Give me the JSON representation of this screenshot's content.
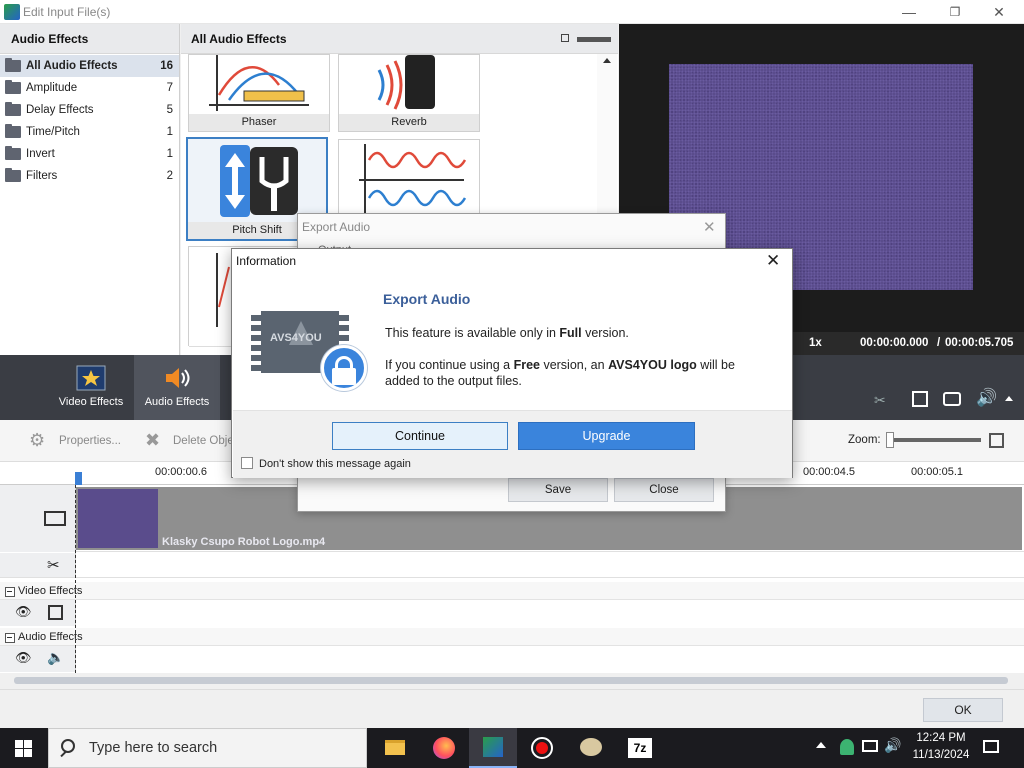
{
  "window": {
    "title": "Edit Input File(s)",
    "minimize_glyph": "—",
    "restore_glyph": "❐",
    "close_glyph": "✕"
  },
  "categories": {
    "header": "Audio Effects",
    "items": [
      {
        "label": "All Audio Effects",
        "count": "16"
      },
      {
        "label": "Amplitude",
        "count": "7"
      },
      {
        "label": "Delay Effects",
        "count": "5"
      },
      {
        "label": "Time/Pitch",
        "count": "1"
      },
      {
        "label": "Invert",
        "count": "1"
      },
      {
        "label": "Filters",
        "count": "2"
      }
    ]
  },
  "gallery": {
    "header": "All Audio Effects",
    "tiles": [
      {
        "label": "Phaser"
      },
      {
        "label": "Reverb"
      },
      {
        "label": "Pitch Shift"
      },
      {
        "label": ""
      }
    ]
  },
  "preview": {
    "speed": "1x",
    "current_time": "00:00:00.000",
    "separator": "/",
    "total_time": "00:00:05.705"
  },
  "toolbar_band": {
    "video_effects_label": "Video Effects",
    "audio_effects_label": "Audio Effects"
  },
  "timeline_toolbar": {
    "properties_label": "Properties...",
    "delete_label": "Delete Obje",
    "zoom_label": "Zoom:"
  },
  "ruler": {
    "ticks": [
      "00:00:00.6",
      "00:00:04.5",
      "00:00:05.1"
    ]
  },
  "tracks": {
    "clip_name": "Klasky Csupo Robot Logo.mp4",
    "video_effects_section": "Video Effects",
    "audio_effects_section": "Audio Effects"
  },
  "ok_label": "OK",
  "export_dialog": {
    "title": "Export Audio",
    "partial_label": "Output",
    "save_label": "Save",
    "close_label": "Close"
  },
  "info_dialog": {
    "title": "Information",
    "heading": "Export Audio",
    "logo_text": "AVS4YOU",
    "line1_pre": "This feature is available only in ",
    "line1_bold": "Full",
    "line1_post": " version.",
    "line2_pre": "If you continue using a ",
    "line2_bold1": "Free",
    "line2_mid": " version, an ",
    "line2_bold2": "AVS4YOU logo",
    "line2_post": " will be",
    "line3": "added to the output files.",
    "continue_label": "Continue",
    "upgrade_label": "Upgrade",
    "dont_show_label": "Don't show this message again",
    "dont_show_checked": false
  },
  "taskbar": {
    "search_placeholder": "Type here to search",
    "apps": [
      "file-explorer",
      "firefox",
      "avs-video-editor",
      "recorder",
      "paint",
      "7zip"
    ],
    "time": "12:24 PM",
    "date": "11/13/2024"
  },
  "colors": {
    "accent": "#3a84dc",
    "heading_blue": "#3b5f9a",
    "dark_band": "#3a3d44",
    "video_purple": "#5a4c8c"
  }
}
